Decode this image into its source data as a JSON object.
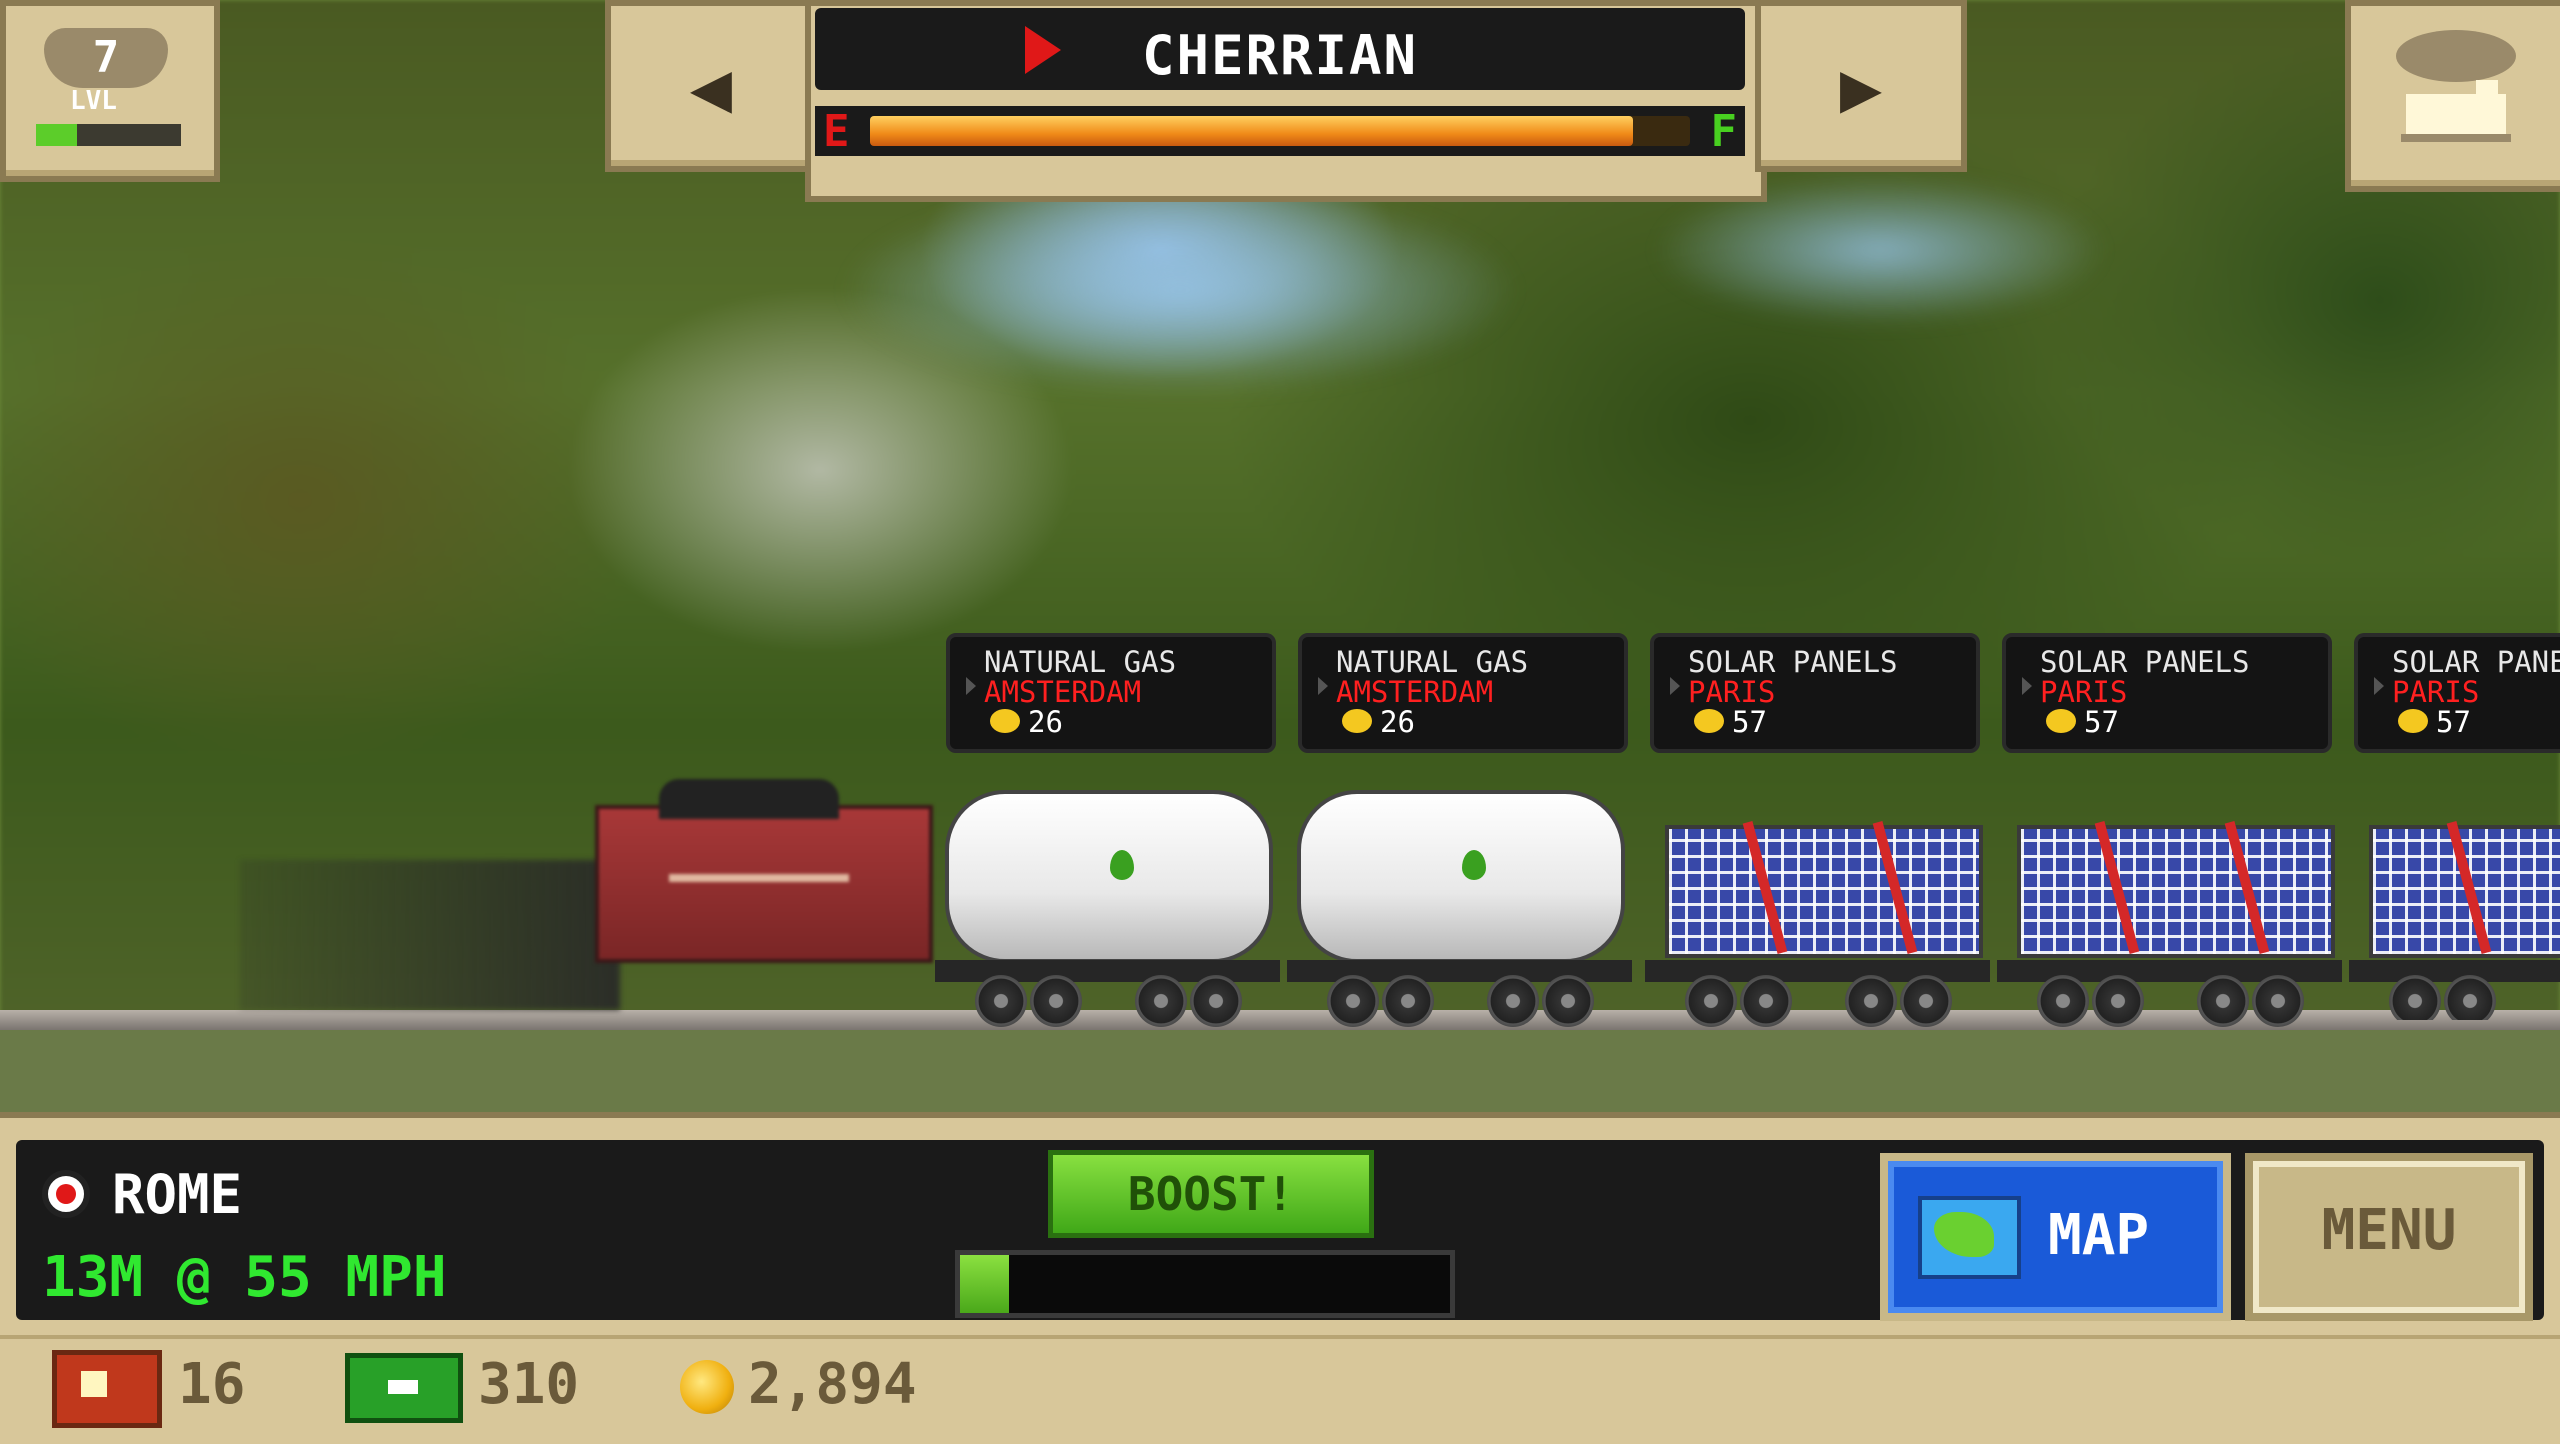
{
  "level": {
    "number": "7",
    "label": "LVL",
    "xp_progress": 0.28
  },
  "train": {
    "name": "CHERRIAN",
    "fuel_empty_label": "E",
    "fuel_full_label": "F",
    "fuel_level": 0.93
  },
  "cargo": [
    {
      "name": "NATURAL GAS",
      "destination": "AMSTERDAM",
      "value": "26",
      "type": "tanker"
    },
    {
      "name": "NATURAL GAS",
      "destination": "AMSTERDAM",
      "value": "26",
      "type": "tanker"
    },
    {
      "name": "SOLAR PANELS",
      "destination": "PARIS",
      "value": "57",
      "type": "solar"
    },
    {
      "name": "SOLAR PANELS",
      "destination": "PARIS",
      "value": "57",
      "type": "solar"
    },
    {
      "name": "SOLAR PANELS",
      "destination": "PARIS",
      "value": "57",
      "type": "solar"
    }
  ],
  "status": {
    "city": "ROME",
    "eta": "13M @ 55 MPH"
  },
  "boost": {
    "label": "BOOST!",
    "progress": 0.1
  },
  "buttons": {
    "map": "MAP",
    "menu": "MENU"
  },
  "currency": {
    "tickets": "16",
    "cash": "310",
    "gold": "2,894"
  },
  "colors": {
    "accent_green": "#30e830",
    "destination_red": "#ff2020",
    "panel_tan": "#d8c79a"
  }
}
